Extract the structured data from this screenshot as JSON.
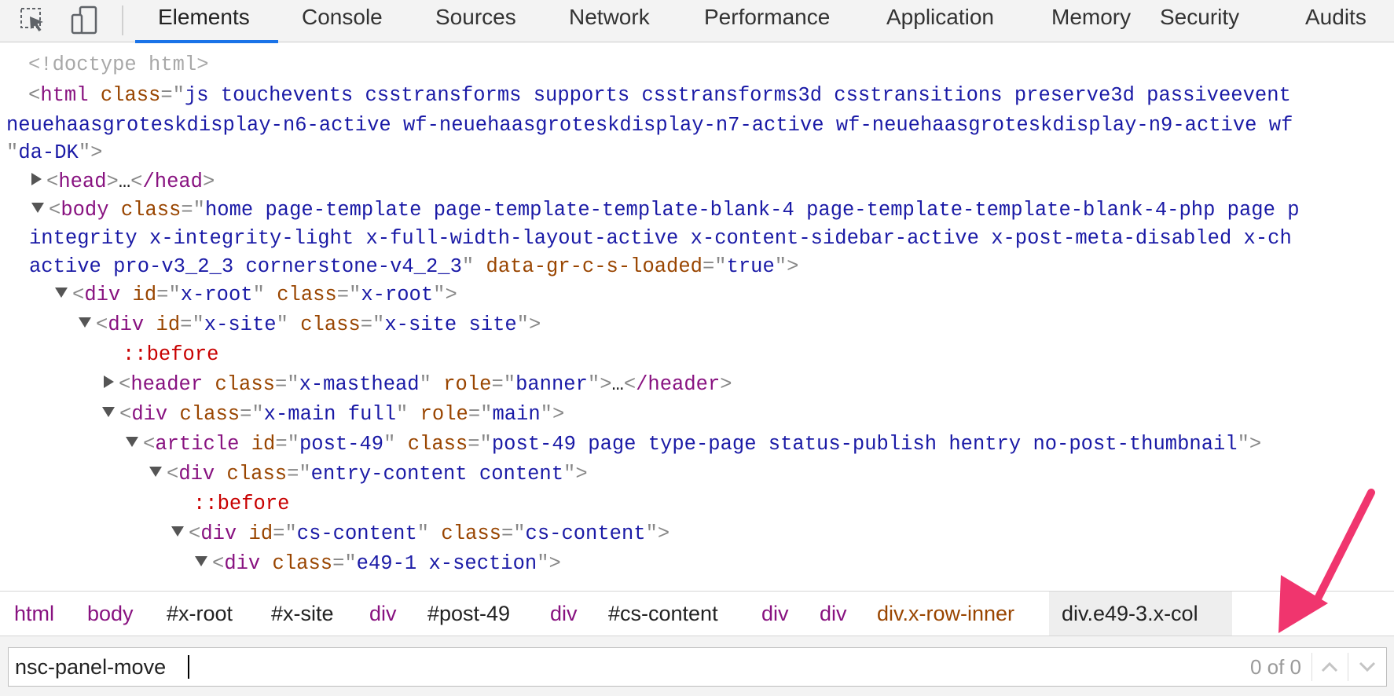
{
  "toolbar": {
    "icons": [
      "inspect-element-icon",
      "device-toolbar-icon"
    ],
    "tabs": [
      "Elements",
      "Console",
      "Sources",
      "Network",
      "Performance",
      "Application",
      "Memory",
      "Security",
      "Audits"
    ],
    "active_tab": "Elements",
    "accent_color": "#1a73e8"
  },
  "tree": {
    "doctype": "<!doctype html>",
    "html_open": "html",
    "html_class_attr": "class",
    "html_class_val_1": "js touchevents csstransforms supports csstransforms3d csstransitions preserve3d passiveevent",
    "html_class_val_2": "neuehaasgroteskdisplay-n6-active wf-neuehaasgroteskdisplay-n7-active wf-neuehaasgroteskdisplay-n9-active wf",
    "html_lang_val": "da-DK",
    "head_tag": "head",
    "head_close": "/head",
    "ellipsis": "…",
    "body_tag": "body",
    "body_class_attr": "class",
    "body_class_val_1": "home page-template page-template-template-blank-4 page-template-template-blank-4-php page p",
    "body_class_val_2": "integrity x-integrity-light x-full-width-layout-active x-content-sidebar-active x-post-meta-disabled x-ch",
    "body_class_val_3": "active pro-v3_2_3 cornerstone-v4_2_3",
    "body_data_attr": "data-gr-c-s-loaded",
    "body_data_val": "true",
    "xroot_tag": "div",
    "xroot_id_attr": "id",
    "xroot_id_val": "x-root",
    "xroot_class_attr": "class",
    "xroot_class_val": "x-root",
    "xsite_tag": "div",
    "xsite_id_attr": "id",
    "xsite_id_val": "x-site",
    "xsite_class_attr": "class",
    "xsite_class_val": "x-site site",
    "before_1": "::before",
    "header_tag": "header",
    "header_class_attr": "class",
    "header_class_val": "x-masthead",
    "header_role_attr": "role",
    "header_role_val": "banner",
    "header_close": "/header",
    "main_tag": "div",
    "main_class_attr": "class",
    "main_class_val": "x-main full",
    "main_role_attr": "role",
    "main_role_val": "main",
    "article_tag": "article",
    "article_id_attr": "id",
    "article_id_val": "post-49",
    "article_class_attr": "class",
    "article_class_val": "post-49 page type-page status-publish hentry no-post-thumbnail",
    "entry_tag": "div",
    "entry_class_attr": "class",
    "entry_class_val": "entry-content content",
    "before_2": "::before",
    "cs_tag": "div",
    "cs_id_attr": "id",
    "cs_id_val": "cs-content",
    "cs_class_attr": "class",
    "cs_class_val": "cs-content",
    "section_tag": "div",
    "section_class_attr": "class",
    "section_class_val": "e49-1 x-section"
  },
  "breadcrumbs": [
    {
      "label": "html",
      "kind": "tag"
    },
    {
      "label": "body",
      "kind": "tag"
    },
    {
      "label": "#x-root",
      "kind": "id"
    },
    {
      "label": "#x-site",
      "kind": "id"
    },
    {
      "label": "div",
      "kind": "tag"
    },
    {
      "label": "#post-49",
      "kind": "id"
    },
    {
      "label": "div",
      "kind": "tag"
    },
    {
      "label": "#cs-content",
      "kind": "id"
    },
    {
      "label": "div",
      "kind": "tag"
    },
    {
      "label": "div",
      "kind": "tag"
    },
    {
      "label": "div.x-row-inner",
      "kind": "class"
    },
    {
      "label": "div.e49-3.x-col",
      "kind": "selected"
    }
  ],
  "search": {
    "value": "nsc-panel-move",
    "match_count": "0 of 0",
    "prev_icon": "chevron-up-icon",
    "next_icon": "chevron-down-icon"
  },
  "annotation": {
    "arrow_color": "#f0356e"
  }
}
